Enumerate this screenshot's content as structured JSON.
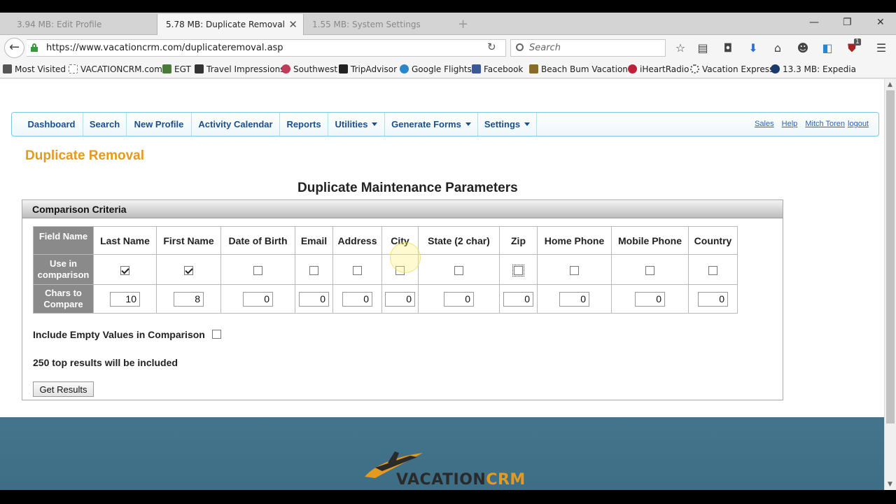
{
  "browser": {
    "tabs": [
      {
        "label": "3.94 MB: Edit Profile",
        "active": false
      },
      {
        "label": "5.78 MB: Duplicate Removal",
        "active": true
      },
      {
        "label": "1.55 MB: System Settings",
        "active": false
      }
    ],
    "url": "https://www.vacationcrm.com/duplicateremoval.asp",
    "search_placeholder": "Search",
    "bookmarks": [
      "Most Visited",
      "VACATIONCRM.com",
      "EGT",
      "Travel Impressions",
      "Southwest",
      "TripAdvisor",
      "Google Flights",
      "Facebook",
      "Beach Bum Vacation™",
      "iHeartRadio",
      "Vacation Express",
      "13.3 MB: Expedia"
    ],
    "notification_badge": "1"
  },
  "app_menu": {
    "items": [
      "Dashboard",
      "Search",
      "New Profile",
      "Activity Calendar",
      "Reports",
      "Utilities",
      "Generate Forms",
      "Settings"
    ],
    "right_links": [
      "Sales",
      "Help",
      "Mitch Toren",
      "logout"
    ]
  },
  "page": {
    "heading": "Duplicate Removal",
    "section_title": "Duplicate Maintenance Parameters",
    "panel_title": "Comparison Criteria",
    "row_labels": {
      "field_name": "Field Name",
      "use_in_comparison": "Use in comparison",
      "chars_to_compare": "Chars to Compare"
    },
    "fields": [
      {
        "name": "Last Name",
        "use": true,
        "chars": "10"
      },
      {
        "name": "First Name",
        "use": true,
        "chars": "8"
      },
      {
        "name": "Date of Birth",
        "use": false,
        "chars": "0"
      },
      {
        "name": "Email",
        "use": false,
        "chars": "0"
      },
      {
        "name": "Address",
        "use": false,
        "chars": "0"
      },
      {
        "name": "City",
        "use": false,
        "chars": "0"
      },
      {
        "name": "State (2 char)",
        "use": false,
        "chars": "0"
      },
      {
        "name": "Zip",
        "use": false,
        "chars": "0"
      },
      {
        "name": "Home Phone",
        "use": false,
        "chars": "0"
      },
      {
        "name": "Mobile Phone",
        "use": false,
        "chars": "0"
      },
      {
        "name": "Country",
        "use": false,
        "chars": "0"
      }
    ],
    "include_empty_label": "Include Empty Values in Comparison",
    "include_empty_checked": false,
    "top_results_text": "250 top results will be included",
    "get_results_label": "Get Results"
  },
  "footer": {
    "logo_text_a": "VACATION",
    "logo_text_b": "CRM"
  },
  "colors": {
    "accent_orange": "#e49a1e",
    "menu_blue": "#1a4f8a",
    "menu_border": "#7cc7e6",
    "footer_bg": "#4a7d95"
  }
}
